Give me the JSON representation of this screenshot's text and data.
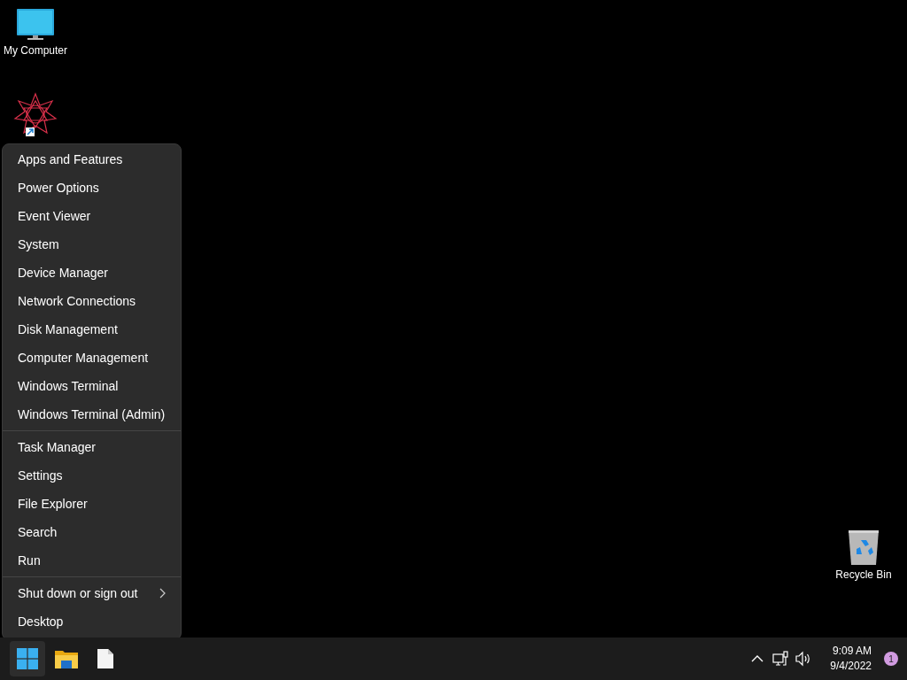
{
  "desktop_icons": [
    {
      "kind": "computer",
      "label": "My Computer"
    },
    {
      "kind": "shortcut"
    },
    {
      "kind": "recycle",
      "label": "Recycle Bin"
    }
  ],
  "context_menu": {
    "sections": [
      {
        "items": [
          {
            "label": "Apps and Features",
            "submenu": false
          },
          {
            "label": "Power Options",
            "submenu": false
          },
          {
            "label": "Event Viewer",
            "submenu": false
          },
          {
            "label": "System",
            "submenu": false
          },
          {
            "label": "Device Manager",
            "submenu": false
          },
          {
            "label": "Network Connections",
            "submenu": false
          },
          {
            "label": "Disk Management",
            "submenu": false
          },
          {
            "label": "Computer Management",
            "submenu": false
          },
          {
            "label": "Windows Terminal",
            "submenu": false
          },
          {
            "label": "Windows Terminal (Admin)",
            "submenu": false
          }
        ]
      },
      {
        "items": [
          {
            "label": "Task Manager",
            "submenu": false
          },
          {
            "label": "Settings",
            "submenu": false
          },
          {
            "label": "File Explorer",
            "submenu": false
          },
          {
            "label": "Search",
            "submenu": false
          },
          {
            "label": "Run",
            "submenu": false
          }
        ]
      },
      {
        "items": [
          {
            "label": "Shut down or sign out",
            "submenu": true
          },
          {
            "label": "Desktop",
            "submenu": false
          }
        ]
      }
    ]
  },
  "taskbar": {
    "apps": [
      {
        "kind": "start",
        "active": true
      },
      {
        "kind": "folder",
        "active": false
      },
      {
        "kind": "file",
        "active": false
      }
    ],
    "tray": [
      {
        "kind": "chevron"
      },
      {
        "kind": "network"
      },
      {
        "kind": "volume"
      }
    ],
    "clock": {
      "time": "9:09 AM",
      "date": "9/4/2022"
    },
    "notification_badge": "1"
  }
}
